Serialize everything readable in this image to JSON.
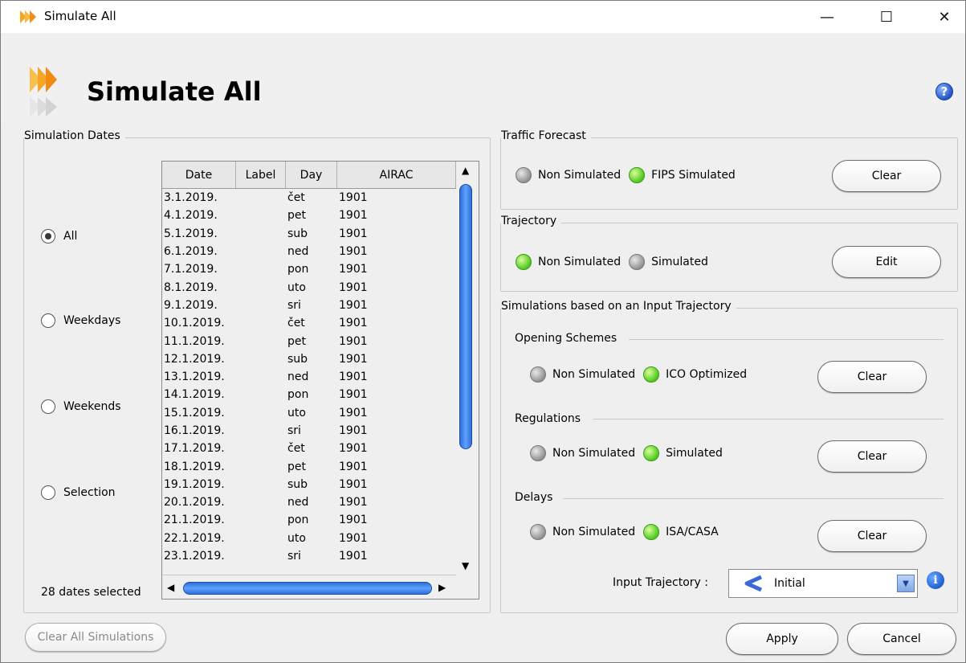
{
  "window": {
    "title": "Simulate All",
    "minimize": "—",
    "maximize": "☐",
    "close": "✕"
  },
  "header": {
    "title": "Simulate All",
    "help": "?"
  },
  "simulation_dates": {
    "title": "Simulation Dates",
    "options": [
      {
        "label": "All",
        "selected": true
      },
      {
        "label": "Weekdays",
        "selected": false
      },
      {
        "label": "Weekends",
        "selected": false
      },
      {
        "label": "Selection",
        "selected": false
      }
    ],
    "count_text": "28 dates selected",
    "columns": [
      "Date",
      "Label",
      "Day",
      "AIRAC"
    ],
    "rows": [
      [
        "3.1.2019.",
        "",
        "čet",
        "1901"
      ],
      [
        "4.1.2019.",
        "",
        "pet",
        "1901"
      ],
      [
        "5.1.2019.",
        "",
        "sub",
        "1901"
      ],
      [
        "6.1.2019.",
        "",
        "ned",
        "1901"
      ],
      [
        "7.1.2019.",
        "",
        "pon",
        "1901"
      ],
      [
        "8.1.2019.",
        "",
        "uto",
        "1901"
      ],
      [
        "9.1.2019.",
        "",
        "sri",
        "1901"
      ],
      [
        "10.1.2019.",
        "",
        "čet",
        "1901"
      ],
      [
        "11.1.2019.",
        "",
        "pet",
        "1901"
      ],
      [
        "12.1.2019.",
        "",
        "sub",
        "1901"
      ],
      [
        "13.1.2019.",
        "",
        "ned",
        "1901"
      ],
      [
        "14.1.2019.",
        "",
        "pon",
        "1901"
      ],
      [
        "15.1.2019.",
        "",
        "uto",
        "1901"
      ],
      [
        "16.1.2019.",
        "",
        "sri",
        "1901"
      ],
      [
        "17.1.2019.",
        "",
        "čet",
        "1901"
      ],
      [
        "18.1.2019.",
        "",
        "pet",
        "1901"
      ],
      [
        "19.1.2019.",
        "",
        "sub",
        "1901"
      ],
      [
        "20.1.2019.",
        "",
        "ned",
        "1901"
      ],
      [
        "21.1.2019.",
        "",
        "pon",
        "1901"
      ],
      [
        "22.1.2019.",
        "",
        "uto",
        "1901"
      ],
      [
        "23.1.2019.",
        "",
        "sri",
        "1901"
      ]
    ]
  },
  "traffic_forecast": {
    "title": "Traffic Forecast",
    "status_a": {
      "label": "Non Simulated",
      "state": "gray"
    },
    "status_b": {
      "label": "FIPS Simulated",
      "state": "green"
    },
    "button": "Clear"
  },
  "trajectory": {
    "title": "Trajectory",
    "status_a": {
      "label": "Non Simulated",
      "state": "green"
    },
    "status_b": {
      "label": "Simulated",
      "state": "gray"
    },
    "button": "Edit"
  },
  "input_trajectory_sims": {
    "title": "Simulations based on an Input Trajectory",
    "opening_schemes": {
      "title": "Opening Schemes",
      "status_a": {
        "label": "Non Simulated",
        "state": "gray"
      },
      "status_b": {
        "label": "ICO Optimized",
        "state": "green"
      },
      "button": "Clear"
    },
    "regulations": {
      "title": "Regulations",
      "status_a": {
        "label": "Non Simulated",
        "state": "gray"
      },
      "status_b": {
        "label": "Simulated",
        "state": "green"
      },
      "button": "Clear"
    },
    "delays": {
      "title": "Delays",
      "status_a": {
        "label": "Non Simulated",
        "state": "gray"
      },
      "status_b": {
        "label": "ISA/CASA",
        "state": "green"
      },
      "button": "Clear"
    },
    "input_trajectory_label": "Input Trajectory :",
    "input_trajectory_value": "Initial",
    "info": "i"
  },
  "footer": {
    "clear_all": "Clear All Simulations",
    "apply": "Apply",
    "cancel": "Cancel"
  },
  "colors": {
    "led_green": "#4fc81e",
    "led_gray": "#8c8c8c",
    "scroll_blue": "#2f70d8"
  }
}
